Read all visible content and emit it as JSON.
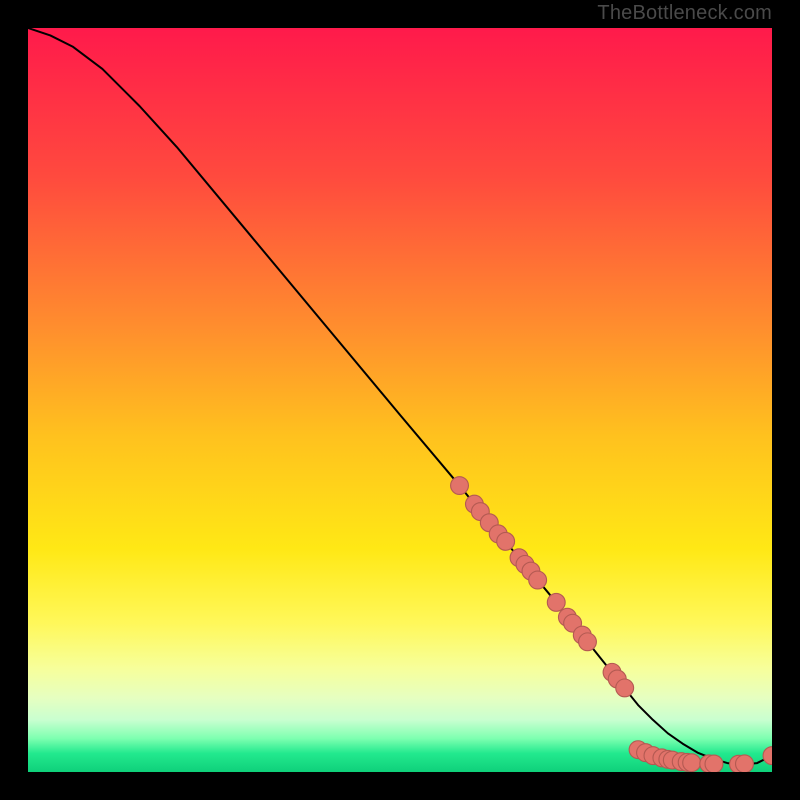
{
  "attribution": "TheBottleneck.com",
  "colors": {
    "line": "#000000",
    "marker_fill": "#e2736a",
    "marker_stroke": "#b45a52",
    "frame_bg": "#000000"
  },
  "gradient_stops": [
    {
      "offset": 0.0,
      "color": "#ff1a4b"
    },
    {
      "offset": 0.2,
      "color": "#ff4a3e"
    },
    {
      "offset": 0.4,
      "color": "#ff8d2e"
    },
    {
      "offset": 0.55,
      "color": "#ffc21e"
    },
    {
      "offset": 0.7,
      "color": "#ffe815"
    },
    {
      "offset": 0.8,
      "color": "#fff85a"
    },
    {
      "offset": 0.86,
      "color": "#f7ff9a"
    },
    {
      "offset": 0.9,
      "color": "#e6ffc0"
    },
    {
      "offset": 0.93,
      "color": "#c9ffd0"
    },
    {
      "offset": 0.955,
      "color": "#7dffb0"
    },
    {
      "offset": 0.975,
      "color": "#22e98e"
    },
    {
      "offset": 1.0,
      "color": "#0fd07a"
    }
  ],
  "chart_data": {
    "type": "line",
    "title": "",
    "xlabel": "",
    "ylabel": "",
    "xlim": [
      0,
      100
    ],
    "ylim": [
      0,
      100
    ],
    "grid": false,
    "legend": false,
    "series": [
      {
        "name": "curve",
        "x": [
          0,
          3,
          6,
          10,
          15,
          20,
          30,
          40,
          50,
          58,
          62,
          66,
          70,
          74,
          78,
          80,
          82,
          84,
          86,
          88,
          90,
          92,
          94,
          96,
          98,
          100
        ],
        "y": [
          100,
          99,
          97.5,
          94.5,
          89.5,
          84,
          72,
          60,
          48,
          38.5,
          33.5,
          28.8,
          24,
          19,
          14,
          11.5,
          9,
          7,
          5.2,
          3.8,
          2.6,
          1.8,
          1.2,
          1,
          1.2,
          2.2
        ]
      }
    ],
    "markers": [
      {
        "x": 58,
        "y": 38.5
      },
      {
        "x": 60,
        "y": 36
      },
      {
        "x": 60.8,
        "y": 35
      },
      {
        "x": 62,
        "y": 33.5
      },
      {
        "x": 63.2,
        "y": 32
      },
      {
        "x": 64.2,
        "y": 31
      },
      {
        "x": 66,
        "y": 28.8
      },
      {
        "x": 66.8,
        "y": 27.9
      },
      {
        "x": 67.6,
        "y": 27
      },
      {
        "x": 68.5,
        "y": 25.8
      },
      {
        "x": 71,
        "y": 22.8
      },
      {
        "x": 72.5,
        "y": 20.8
      },
      {
        "x": 73.2,
        "y": 20
      },
      {
        "x": 74.5,
        "y": 18.4
      },
      {
        "x": 75.2,
        "y": 17.5
      },
      {
        "x": 78.5,
        "y": 13.4
      },
      {
        "x": 79.2,
        "y": 12.5
      },
      {
        "x": 80.2,
        "y": 11.3
      },
      {
        "x": 82,
        "y": 3
      },
      {
        "x": 83,
        "y": 2.6
      },
      {
        "x": 84,
        "y": 2.2
      },
      {
        "x": 85.2,
        "y": 1.9
      },
      {
        "x": 86,
        "y": 1.7
      },
      {
        "x": 86.6,
        "y": 1.6
      },
      {
        "x": 87.8,
        "y": 1.4
      },
      {
        "x": 88.6,
        "y": 1.3
      },
      {
        "x": 89.2,
        "y": 1.25
      },
      {
        "x": 91.5,
        "y": 1.1
      },
      {
        "x": 92.2,
        "y": 1.08
      },
      {
        "x": 95.5,
        "y": 1.05
      },
      {
        "x": 96.3,
        "y": 1.1
      },
      {
        "x": 100,
        "y": 2.2
      }
    ],
    "marker_radius": 1.2
  }
}
